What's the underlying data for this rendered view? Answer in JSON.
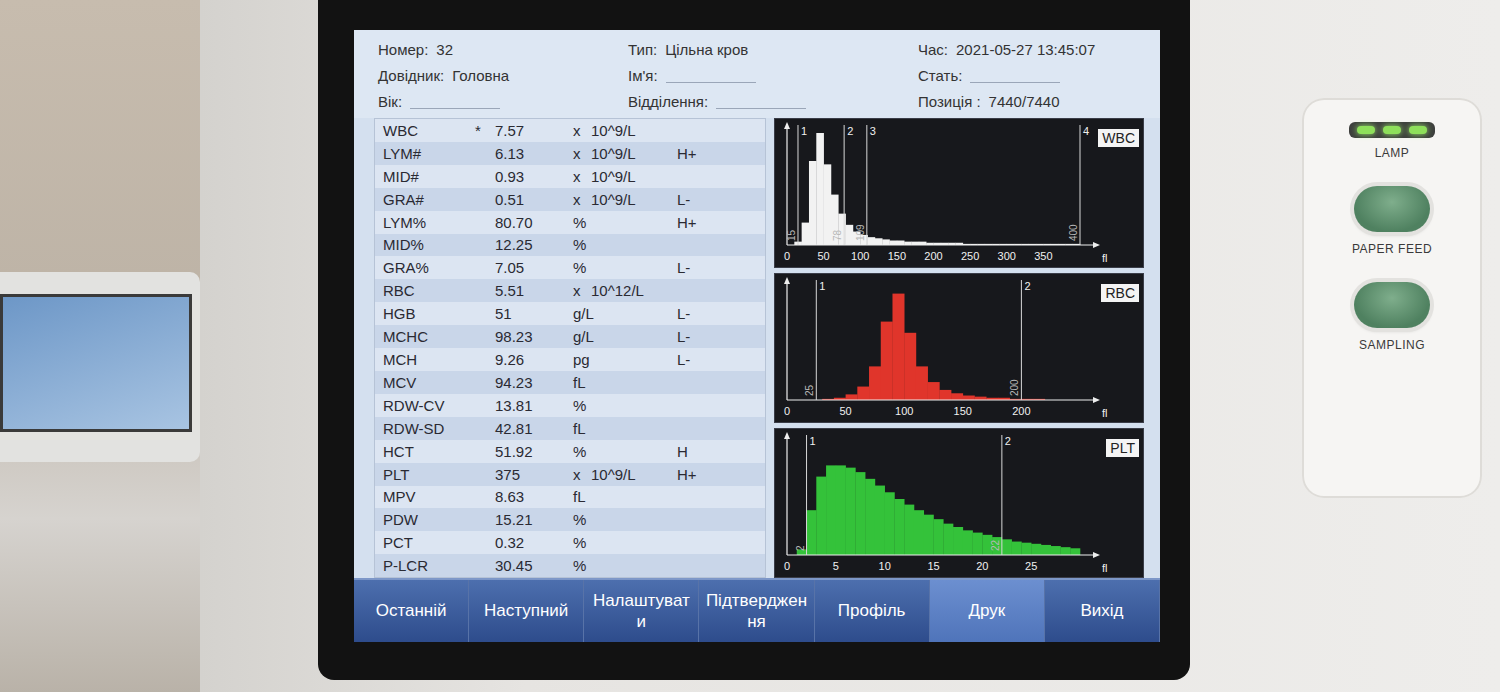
{
  "header": {
    "fields": [
      {
        "label": "Номер:",
        "value": "32"
      },
      {
        "label": "Довідник:",
        "value": "Головна"
      },
      {
        "label": "Вік:",
        "value": ""
      },
      {
        "label": "Тип:",
        "value": "Цільна кров"
      },
      {
        "label": "Ім'я:",
        "value": ""
      },
      {
        "label": "Відділення:",
        "value": ""
      },
      {
        "label": "Час:",
        "value": "2021-05-27 13:45:07"
      },
      {
        "label": "Стать:",
        "value": ""
      },
      {
        "label": "Позиція :",
        "value": "7440/7440"
      }
    ]
  },
  "results": [
    {
      "name": "WBC",
      "mark": "*",
      "value": "7.57",
      "mult": "x",
      "unit": "10^9/L",
      "flag": ""
    },
    {
      "name": "LYM#",
      "mark": "",
      "value": "6.13",
      "mult": "x",
      "unit": "10^9/L",
      "flag": "H+"
    },
    {
      "name": "MID#",
      "mark": "",
      "value": "0.93",
      "mult": "x",
      "unit": "10^9/L",
      "flag": ""
    },
    {
      "name": "GRA#",
      "mark": "",
      "value": "0.51",
      "mult": "x",
      "unit": "10^9/L",
      "flag": "L-"
    },
    {
      "name": "LYM%",
      "mark": "",
      "value": "80.70",
      "mult": "",
      "unit": "%",
      "flag": "H+"
    },
    {
      "name": "MID%",
      "mark": "",
      "value": "12.25",
      "mult": "",
      "unit": "%",
      "flag": ""
    },
    {
      "name": "GRA%",
      "mark": "",
      "value": "7.05",
      "mult": "",
      "unit": "%",
      "flag": "L-"
    },
    {
      "name": "RBC",
      "mark": "",
      "value": "5.51",
      "mult": "x",
      "unit": "10^12/L",
      "flag": ""
    },
    {
      "name": "HGB",
      "mark": "",
      "value": "51",
      "mult": "",
      "unit": "g/L",
      "flag": "L-"
    },
    {
      "name": "MCHC",
      "mark": "",
      "value": "98.23",
      "mult": "",
      "unit": "g/L",
      "flag": "L-"
    },
    {
      "name": "MCH",
      "mark": "",
      "value": "9.26",
      "mult": "",
      "unit": "pg",
      "flag": "L-"
    },
    {
      "name": "MCV",
      "mark": "",
      "value": "94.23",
      "mult": "",
      "unit": "fL",
      "flag": ""
    },
    {
      "name": "RDW-CV",
      "mark": "",
      "value": "13.81",
      "mult": "",
      "unit": "%",
      "flag": ""
    },
    {
      "name": "RDW-SD",
      "mark": "",
      "value": "42.81",
      "mult": "",
      "unit": "fL",
      "flag": ""
    },
    {
      "name": "HCT",
      "mark": "",
      "value": "51.92",
      "mult": "",
      "unit": "%",
      "flag": "H"
    },
    {
      "name": "PLT",
      "mark": "",
      "value": "375",
      "mult": "x",
      "unit": "10^9/L",
      "flag": "H+"
    },
    {
      "name": "MPV",
      "mark": "",
      "value": "8.63",
      "mult": "",
      "unit": "fL",
      "flag": ""
    },
    {
      "name": "PDW",
      "mark": "",
      "value": "15.21",
      "mult": "",
      "unit": "%",
      "flag": ""
    },
    {
      "name": "PCT",
      "mark": "",
      "value": "0.32",
      "mult": "",
      "unit": "%",
      "flag": ""
    },
    {
      "name": "P-LCR",
      "mark": "",
      "value": "30.45",
      "mult": "",
      "unit": "%",
      "flag": ""
    }
  ],
  "charts": [
    {
      "label": "WBC",
      "color": "#f2f2f2",
      "x_max": 400,
      "axis_ticks": [
        "0",
        "50",
        "100",
        "150",
        "200",
        "250",
        "300",
        "350"
      ],
      "axis_unit": "fl",
      "markers": [
        {
          "index": "1",
          "value": "15"
        },
        {
          "index": "2",
          "value": "78"
        },
        {
          "index": "3",
          "value": "109"
        },
        {
          "index": "4",
          "value": "400"
        }
      ],
      "series": [
        0,
        3,
        20,
        75,
        100,
        72,
        45,
        28,
        18,
        12,
        9,
        7,
        6,
        5,
        4,
        4,
        3,
        3,
        3,
        2,
        2,
        2,
        2,
        2,
        1,
        1,
        1,
        1,
        1,
        1,
        1,
        1,
        1,
        1,
        1,
        1,
        1,
        1,
        1,
        1
      ]
    },
    {
      "label": "RBC",
      "color": "#e0352b",
      "x_max": 250,
      "axis_ticks": [
        "0",
        "50",
        "100",
        "150",
        "200"
      ],
      "axis_unit": "fl",
      "markers": [
        {
          "index": "1",
          "value": "25"
        },
        {
          "index": "2",
          "value": "200"
        }
      ],
      "series": [
        0,
        0,
        0,
        1,
        2,
        5,
        12,
        30,
        70,
        95,
        60,
        30,
        16,
        9,
        6,
        4,
        3,
        2,
        2,
        1,
        1,
        1,
        0,
        0,
        0
      ]
    },
    {
      "label": "PLT",
      "color": "#34c23a",
      "x_max": 30,
      "axis_ticks": [
        "0",
        "5",
        "10",
        "15",
        "20",
        "25"
      ],
      "axis_unit": "fl",
      "markers": [
        {
          "index": "1",
          "value": "2"
        },
        {
          "index": "2",
          "value": "22"
        }
      ],
      "series": [
        0,
        5,
        40,
        70,
        80,
        80,
        78,
        74,
        68,
        62,
        56,
        50,
        45,
        40,
        36,
        32,
        28,
        25,
        22,
        20,
        18,
        16,
        14,
        12,
        11,
        10,
        9,
        8,
        7,
        6
      ]
    }
  ],
  "toolbar": [
    {
      "label": "Останній",
      "selected": false
    },
    {
      "label": "Наступний",
      "selected": false
    },
    {
      "label": "Налаштувати",
      "selected": false
    },
    {
      "label": "Підтвердження",
      "selected": false
    },
    {
      "label": "Профіль",
      "selected": false
    },
    {
      "label": "Друк",
      "selected": true
    },
    {
      "label": "Вихід",
      "selected": false
    }
  ],
  "device_panel": {
    "lamp": {
      "label": "LAMP",
      "leds": [
        {
          "on": true
        },
        {
          "on": true
        },
        {
          "on": true
        }
      ]
    },
    "buttons": [
      "PAPER FEED",
      "SAMPLING"
    ]
  }
}
